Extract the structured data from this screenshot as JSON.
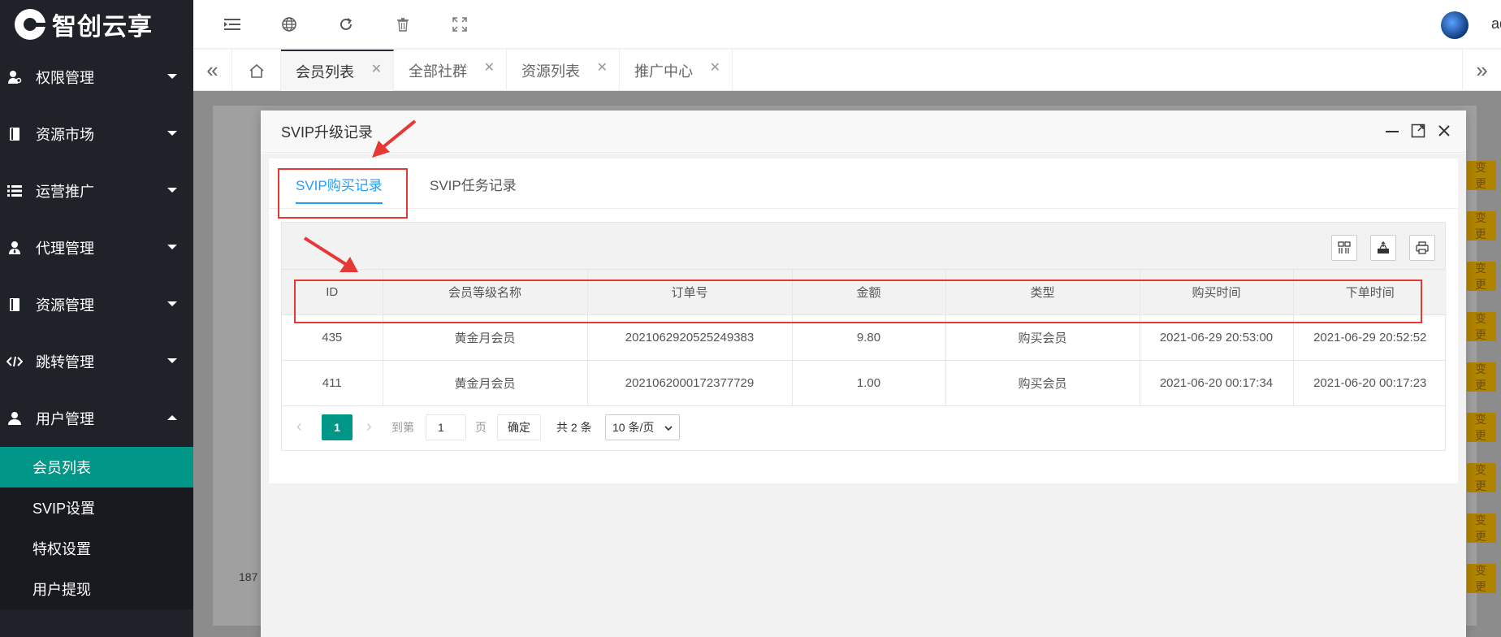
{
  "brand": {
    "name": "智创云享"
  },
  "sidebar": {
    "items": [
      {
        "label": "权限管理",
        "icon": "key-user-icon"
      },
      {
        "label": "资源市场",
        "icon": "book-icon"
      },
      {
        "label": "运营推广",
        "icon": "list-icon"
      },
      {
        "label": "代理管理",
        "icon": "agent-user-icon"
      },
      {
        "label": "资源管理",
        "icon": "book-icon"
      },
      {
        "label": "跳转管理",
        "icon": "code-icon"
      },
      {
        "label": "用户管理",
        "icon": "user-icon"
      }
    ],
    "subitems": [
      {
        "label": "会员列表",
        "active": true
      },
      {
        "label": "SVIP设置"
      },
      {
        "label": "特权设置"
      },
      {
        "label": "用户提现"
      }
    ]
  },
  "header": {
    "icons": [
      "menu-collapse-icon",
      "globe-icon",
      "refresh-icon",
      "trash-icon",
      "fullscreen-icon"
    ],
    "username": "ad"
  },
  "tabs": {
    "items": [
      {
        "label": "会员列表",
        "active": true
      },
      {
        "label": "全部社群"
      },
      {
        "label": "资源列表"
      },
      {
        "label": "推广中心"
      }
    ]
  },
  "backdrop": {
    "button_label": "变更",
    "row_number": "187"
  },
  "modal": {
    "title": "SVIP升级记录",
    "tabs": [
      {
        "label": "SVIP购买记录",
        "active": true
      },
      {
        "label": "SVIP任务记录"
      }
    ],
    "table": {
      "columns": [
        "ID",
        "会员等级名称",
        "订单号",
        "金额",
        "类型",
        "购买时间",
        "下单时间"
      ],
      "rows": [
        [
          "435",
          "黄金月会员",
          "2021062920525249383",
          "9.80",
          "购买会员",
          "2021-06-29 20:53:00",
          "2021-06-29 20:52:52"
        ],
        [
          "411",
          "黄金月会员",
          "2021062000172377729",
          "1.00",
          "购买会员",
          "2021-06-20 00:17:34",
          "2021-06-20 00:17:23"
        ]
      ]
    },
    "pager": {
      "current": "1",
      "goto_label": "到第",
      "input_value": "1",
      "page_label": "页",
      "confirm": "确定",
      "total": "共 2 条",
      "per_page": "10 条/页"
    }
  },
  "colors": {
    "sidebar_bg": "#20222a",
    "active_green": "#009688",
    "tab_blue": "#1e9fff",
    "annotation_red": "#e53935"
  }
}
